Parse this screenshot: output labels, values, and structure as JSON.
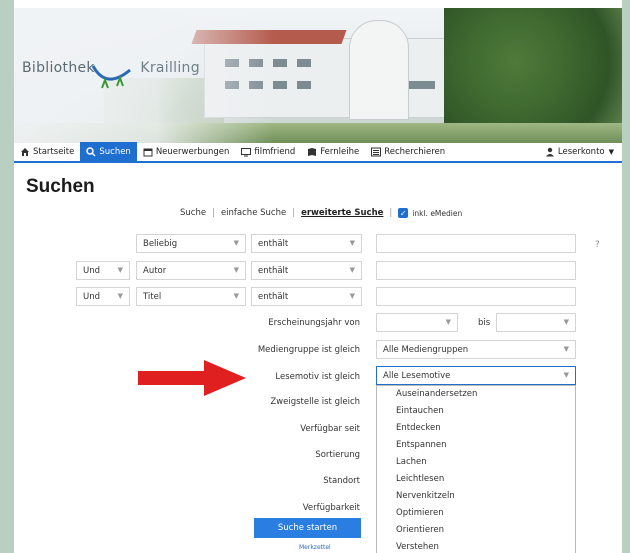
{
  "brand": {
    "logo_text": "Bibliothek",
    "logo_text2": "Krailling"
  },
  "nav": {
    "items": [
      {
        "label": "Startseite",
        "icon": "home-icon"
      },
      {
        "label": "Suchen",
        "icon": "search-icon"
      },
      {
        "label": "Neuerwerbungen",
        "icon": "calendar-icon"
      },
      {
        "label": "filmfriend",
        "icon": "monitor-icon"
      },
      {
        "label": "Fernleihe",
        "icon": "book-icon"
      },
      {
        "label": "Recherchieren",
        "icon": "list-icon"
      }
    ],
    "account_label": "Leserkonto"
  },
  "page_title": "Suchen",
  "modes": {
    "suche": "Suche",
    "einfache": "einfache Suche",
    "erweiterte": "erweiterte Suche",
    "emedien": "inkl. eMedien"
  },
  "rows": [
    {
      "op": "",
      "field": "Beliebig",
      "match": "enthält",
      "value": ""
    },
    {
      "op": "Und",
      "field": "Autor",
      "match": "enthält",
      "value": ""
    },
    {
      "op": "Und",
      "field": "Titel",
      "match": "enthält",
      "value": ""
    }
  ],
  "help_label": "?",
  "labels": {
    "year": "Erscheinungsjahr von",
    "bis": "bis",
    "mediengruppe": "Mediengruppe ist gleich",
    "lesemotiv": "Lesemotiv ist gleich",
    "zweigstelle": "Zweigstelle ist gleich",
    "verfuegbar_seit": "Verfügbar seit",
    "sortierung": "Sortierung",
    "standort": "Standort",
    "verfuegbarkeit": "Verfügbarkeit"
  },
  "mediengruppe_value": "Alle Mediengruppen",
  "lesemotiv_value": "Alle Lesemotive",
  "lesemotiv_options": [
    "Auseinandersetzen",
    "Eintauchen",
    "Entdecken",
    "Entspannen",
    "Lachen",
    "Leichtlesen",
    "Nervenkitzeln",
    "Optimieren",
    "Orientieren",
    "Verstehen"
  ],
  "submit_label": "Suche starten",
  "bottom_link": "Merkzettel",
  "colors": {
    "accent": "#1e6fd0",
    "arrow": "#e02020",
    "frame": "#b9cfc2"
  }
}
